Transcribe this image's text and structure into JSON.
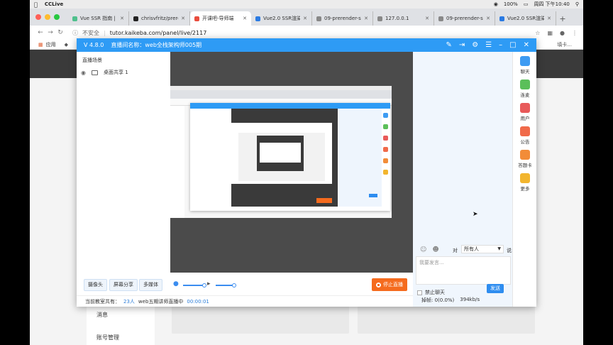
{
  "menubar": {
    "app_name": "CCLive",
    "battery": "100%",
    "datetime": "周四 下午10:40"
  },
  "tabs": [
    {
      "title": "Vue SSR 指南 | Vu",
      "color": "#4fc08d"
    },
    {
      "title": "chrisvfritz/prere",
      "color": "#222222"
    },
    {
      "title": "开课吧-导师端",
      "color": "#e94c3d",
      "active": true
    },
    {
      "title": "Vue2.0 SSR渲染",
      "color": "#2a7ae2"
    },
    {
      "title": "09-prerender-sp",
      "color": "#888888"
    },
    {
      "title": "127.0.0.1",
      "color": "#888888"
    },
    {
      "title": "09-prerender-sp",
      "color": "#888888"
    },
    {
      "title": "Vue2.0 SSR渲染",
      "color": "#2a7ae2"
    }
  ],
  "address": {
    "security": "不安全",
    "url": "tutor.kaikeba.com/panel/live/2117"
  },
  "bookmarks": {
    "apps": "应用",
    "right_fragment": "填卡..."
  },
  "page": {
    "side_items": [
      "消息",
      "账号管理"
    ]
  },
  "live_window": {
    "version": "V 4.8.0",
    "room_name": "直播间名称：web全栈架构师005期",
    "scene_header": "直播场景",
    "scene_item": "桌面共享 1",
    "sidebar": [
      {
        "label": "聊天",
        "color": "#3d9bf2",
        "icon": "chat-icon"
      },
      {
        "label": "连麦",
        "color": "#5bbf5a",
        "icon": "mic-link-icon"
      },
      {
        "label": "用户",
        "color": "#e85a5a",
        "icon": "user-icon"
      },
      {
        "label": "公告",
        "color": "#f06a4a",
        "icon": "announcement-icon"
      },
      {
        "label": "答题卡",
        "color": "#f28c38",
        "icon": "quiz-card-icon"
      },
      {
        "label": "更多",
        "color": "#f2b52e",
        "icon": "more-icon"
      }
    ],
    "bottom": {
      "camera": "摄像头",
      "screen_share": "屏幕分享",
      "multimedia": "多媒体",
      "mic_level": 0.75,
      "speaker_level": 0.75,
      "stop_live": "停止直播"
    },
    "status": {
      "prefix": "当前教室共有：",
      "count": "23人",
      "live_text": "web五期讲师直播中",
      "timer": "00:00:01"
    },
    "chat": {
      "to_label": "对",
      "target": "所有人",
      "say_label": "说:",
      "placeholder": "我要发言...",
      "ban_label": "禁止聊天",
      "send": "发送",
      "dropped": "掉帧: 0(0.0%)",
      "bitrate": "394kb/s"
    }
  }
}
